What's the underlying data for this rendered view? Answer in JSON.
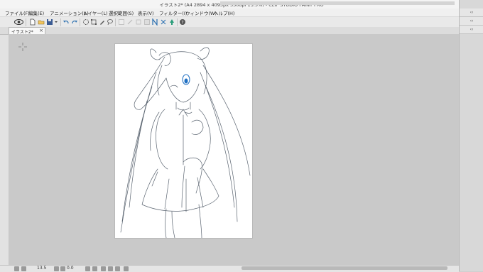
{
  "window": {
    "title": "イラスト2* (A4 2894 x 4093px 350dpi 13.5%) - CLIP STUDIO PAINT PRO",
    "controls": [
      "–",
      "□",
      "×"
    ]
  },
  "menu": {
    "items": [
      "ファイル(F)",
      "編集(E)",
      "アニメーション(A)",
      "レイヤー(L)",
      "選択範囲(S)",
      "表示(V)",
      "フィルター(I)",
      "ウィンドウ(W)",
      "ヘルプ(H)"
    ]
  },
  "document_tab": {
    "label": "イラスト2*",
    "close": "×"
  },
  "status": {
    "zoom": "13.5",
    "rotation": "0.0"
  },
  "colors": {
    "accent": "#2a6fb0",
    "paper": "#ffffff",
    "canvas_bg": "#c9c9c9",
    "line_art": "#5a6470",
    "eye_blue": "#1f6fc2"
  }
}
